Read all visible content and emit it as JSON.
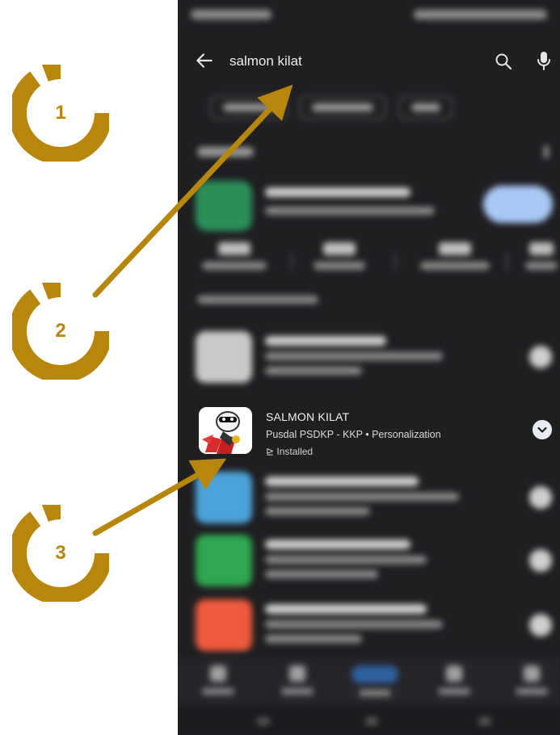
{
  "search": {
    "query": "salmon kilat"
  },
  "featured_app": {
    "name": "SALMON KILAT",
    "developer": "Pusdal PSDKP - KKP",
    "category": "Personalization",
    "status": "Installed"
  },
  "annotations": [
    {
      "number": "1"
    },
    {
      "number": "2"
    },
    {
      "number": "3"
    }
  ],
  "colors": {
    "annotation": "#b8860b",
    "phone_background": "#1f1f22",
    "install_button": "#a9c8f5"
  }
}
